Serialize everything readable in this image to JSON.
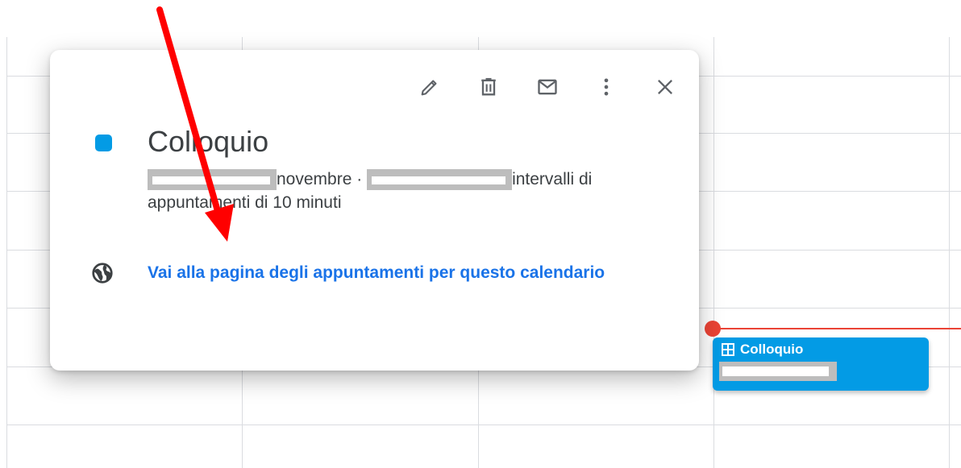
{
  "popup": {
    "toolbar": {
      "edit": "edit-icon",
      "delete": "delete-icon",
      "email": "email-icon",
      "more": "more-options-icon",
      "close": "close-icon"
    },
    "title": "Colloquio",
    "date_suffix": "novembre",
    "separator": "·",
    "interval_text": "intervalli di appuntamenti di 10 minuti",
    "booking_link": "Vai alla pagina degli appuntamenti per questo calendario"
  },
  "event_chip": {
    "title": "Colloquio",
    "icon": "appointment-grid-icon"
  },
  "colors": {
    "event": "#039be5",
    "now_line": "#ea4335",
    "link": "#1a73e8",
    "annotation_arrow": "#ff0000"
  }
}
